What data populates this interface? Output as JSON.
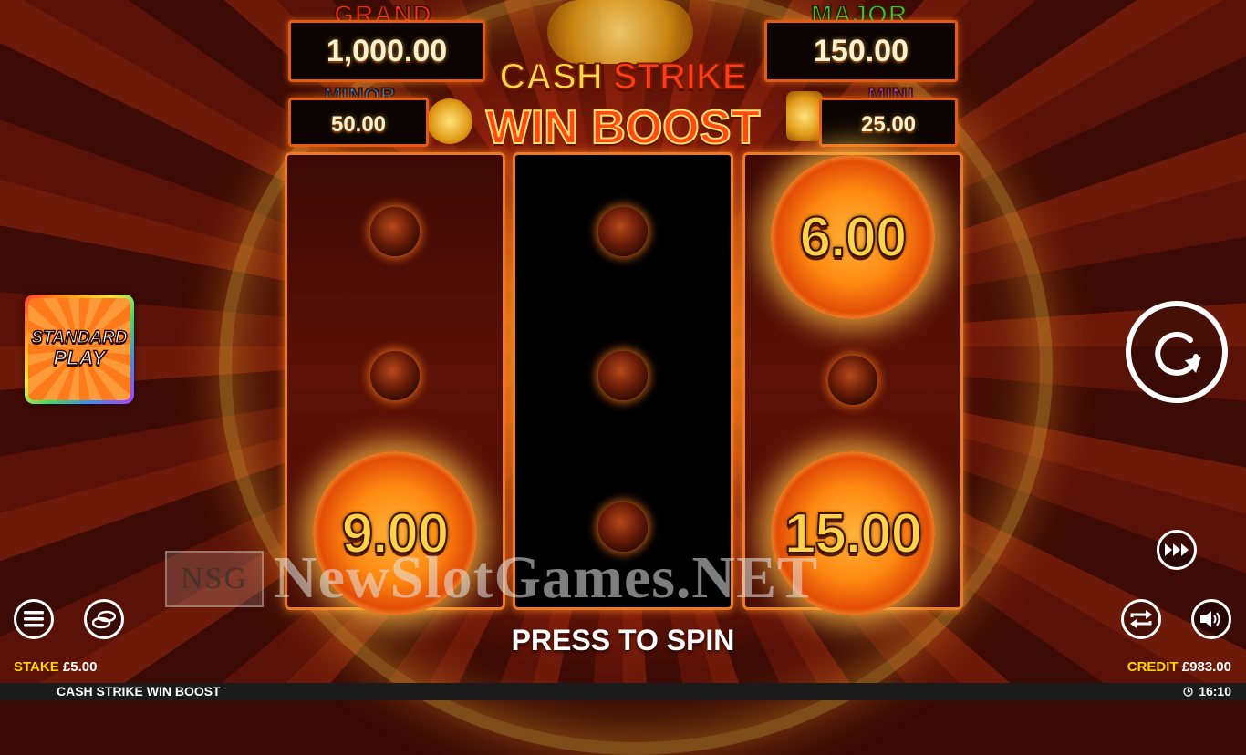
{
  "game": {
    "logo_line1_a": "CASH",
    "logo_line1_b": "STRIKE",
    "logo_line2": "WIN BOOST"
  },
  "jackpots": {
    "grand": {
      "title": "GRAND",
      "value": "1,000.00",
      "color": "#ff2a12"
    },
    "major": {
      "title": "MAJOR",
      "value": "150.00",
      "color": "#2fcf2a"
    },
    "minor": {
      "title": "MINOR",
      "value": "50.00",
      "color": "#2a8cff"
    },
    "mini": {
      "title": "MINI",
      "value": "25.00",
      "color": "#c23aff"
    }
  },
  "reels": [
    {
      "style": "red",
      "symbols": [
        "ember",
        "ember",
        "cash"
      ],
      "cash_value": "9.00"
    },
    {
      "style": "dark",
      "symbols": [
        "ember",
        "ember",
        "ember"
      ]
    },
    {
      "style": "red",
      "symbols": [
        "cash",
        "ember",
        "cash"
      ],
      "cash_values": [
        "6.00",
        "15.00"
      ]
    }
  ],
  "left_panel": {
    "mode_line1": "STANDARD",
    "mode_line2": "PLAY"
  },
  "watermark": {
    "initials": "NSG",
    "text": "NewSlotGames.NET"
  },
  "controls": {
    "press_to_spin": "PRESS TO SPIN",
    "stake_label": "STAKE",
    "stake_value": "£5.00",
    "credit_label": "CREDIT",
    "credit_value": "£983.00",
    "icons": [
      "menu-icon",
      "coins-icon",
      "autoplay-icon",
      "sound-icon",
      "fast-forward-icon",
      "spin-icon"
    ]
  },
  "status_bar": {
    "game_title": "CASH STRIKE WIN BOOST",
    "time": "16:10"
  }
}
